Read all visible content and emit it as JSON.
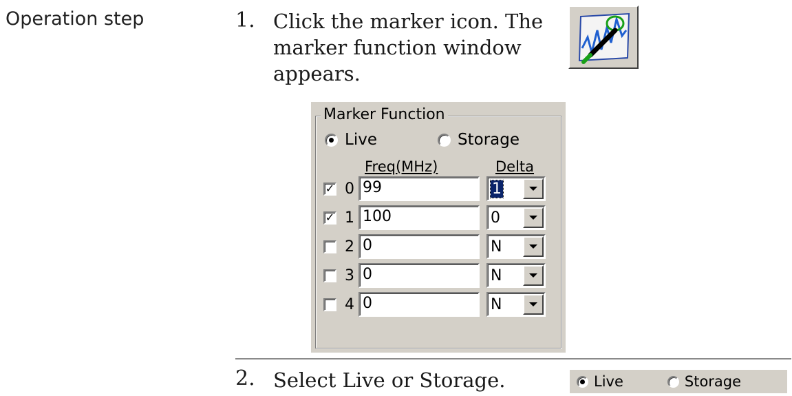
{
  "section_label": "Operation step",
  "steps": [
    {
      "number": "1.",
      "lines": [
        "Click the marker icon. The",
        "marker function window",
        "appears."
      ]
    },
    {
      "number": "2.",
      "lines": [
        "Select Live or Storage."
      ]
    }
  ],
  "icon": "marker-icon",
  "panel": {
    "title": "Marker Function",
    "mode_options": [
      {
        "label": "Live",
        "selected": true
      },
      {
        "label": "Storage",
        "selected": false
      }
    ],
    "columns": {
      "freq": "Freq(MHz)",
      "delta": "Delta"
    },
    "markers": [
      {
        "index": "0",
        "checked": "✓",
        "freq": "99",
        "delta": "1"
      },
      {
        "index": "1",
        "checked": "✓",
        "freq": "100",
        "delta": "0"
      },
      {
        "index": "2",
        "checked": "",
        "freq": "0",
        "delta": "N"
      },
      {
        "index": "3",
        "checked": "",
        "freq": "0",
        "delta": "N"
      },
      {
        "index": "4",
        "checked": "",
        "freq": "0",
        "delta": "N"
      }
    ]
  },
  "strip": {
    "live": "Live",
    "storage": "Storage"
  },
  "colors": {
    "panel_bg": "#d4d0c8",
    "selection": "#0a246a",
    "rule": "#8a8a8a"
  }
}
